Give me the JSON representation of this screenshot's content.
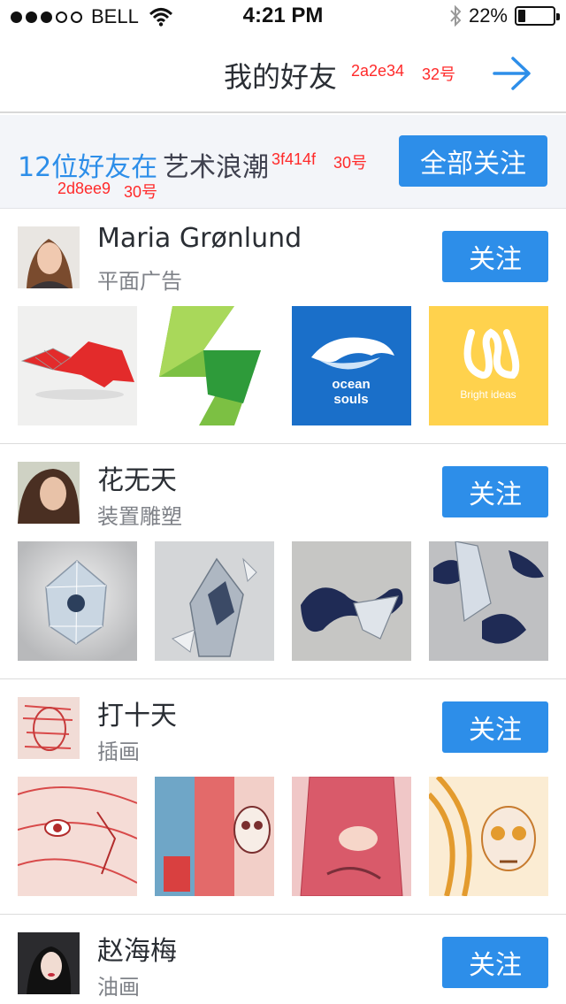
{
  "status_bar": {
    "carrier": "BELL",
    "time": "4:21 PM",
    "battery_percent_text": "22%",
    "battery_level": 0.22,
    "signal_dots_filled": 3,
    "signal_dots_total": 5
  },
  "nav": {
    "title": "我的好友",
    "annotation_color": "2a2e34",
    "annotation_size": "32号",
    "arrow_icon": "arrow-right-icon"
  },
  "summary": {
    "count_text": "12位好友在",
    "count_color": "2d8ee9",
    "count_size": "30号",
    "group_text": "艺术浪潮",
    "group_color": "3f414f",
    "group_size": "30号",
    "follow_all_label": "全部关注"
  },
  "friends": [
    {
      "name": "Maria Grønlund",
      "category": "平面广告",
      "follow_label": "关注",
      "works": [
        "red-rabbit-artwork",
        "green-s-logo-artwork",
        "ocean-souls-logo",
        "bright-ideas-logo"
      ],
      "work_texts": {
        "ocean_line1": "ocean",
        "ocean_line2": "souls",
        "bright": "Bright ideas"
      }
    },
    {
      "name": "花无天",
      "category": "装置雕塑",
      "follow_label": "关注",
      "works": [
        "glass-sphere-sculpture",
        "glass-shards-sculpture",
        "blue-ribbon-sculpture",
        "blue-fragments-sculpture"
      ]
    },
    {
      "name": "打十天",
      "category": "插画",
      "follow_label": "关注",
      "works": [
        "red-face-illustration",
        "kiss-skull-illustration",
        "pink-dress-illustration",
        "golden-skull-illustration"
      ]
    },
    {
      "name": "赵海梅",
      "category": "油画",
      "follow_label": "关注"
    }
  ],
  "colors": {
    "accent": "#2d8ee9",
    "title_text": "#2a2e34",
    "group_text": "#3f414f",
    "annotation": "#ff2a2a",
    "summary_bg": "#f3f5f9"
  }
}
